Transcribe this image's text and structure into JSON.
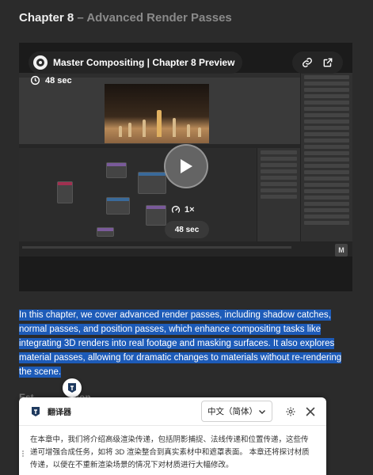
{
  "chapter": {
    "number_label": "Chapter 8",
    "separator": "–",
    "title": "Advanced Render Passes"
  },
  "video": {
    "title": "Master Compositing | Chapter 8 Preview",
    "duration_badge": "48 sec",
    "speed_label": "1×",
    "duration_chip": "48 sec",
    "corner_mark": "M",
    "icons": [
      "clock-icon",
      "link-icon",
      "external-link-icon",
      "play-icon",
      "speed-icon"
    ]
  },
  "description": "In this chapter, we cover advanced render passes, including shadow catches, normal passes, and position passes, which enhance compositing tasks like integrating 3D renders into real footage and masking surfaces. It also explores material passes, allowing for dramatic changes to materials without re-rendering the scene.",
  "faded_heading": "Est. ... ... ...ation",
  "translator": {
    "name": "翻译器",
    "language": "中文（简体）",
    "text": "在本章中，我们将介绍高级渲染传递，包括阴影捕捉、法线传递和位置传递，这些传递可增强合成任务，如将 3D 渲染整合到真实素材中和遮罩表面。 本章还将探讨材质传递，以便在不重新渲染场景的情况下对材质进行大幅修改。"
  },
  "colors": {
    "page_bg": "#2b2b2b",
    "selection": "#1d5bb8",
    "panel_bg": "#ffffff"
  }
}
